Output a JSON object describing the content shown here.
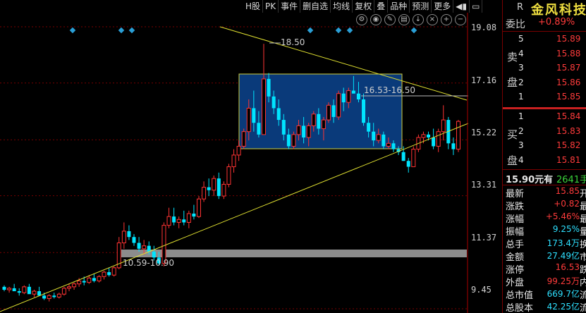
{
  "toolbar": [
    "H股",
    "PK",
    "事件",
    "删自选",
    "均线",
    "复权",
    "叠",
    "品种",
    "预测",
    "更多"
  ],
  "stock_name": "金风科技",
  "stock_code_mark": "R",
  "weibi": {
    "label": "委比",
    "value": "+0.89%"
  },
  "asks": [
    {
      "level": "5",
      "price": "15.89"
    },
    {
      "level": "4",
      "price": "15.88"
    },
    {
      "level": "3",
      "price": "15.87"
    },
    {
      "level": "2",
      "price": "15.86"
    },
    {
      "level": "1",
      "price": "15.85"
    }
  ],
  "ask_side_label": [
    "卖",
    "盘"
  ],
  "bids": [
    {
      "level": "1",
      "price": "15.84"
    },
    {
      "level": "2",
      "price": "15.83"
    },
    {
      "level": "3",
      "price": "15.82"
    },
    {
      "level": "4",
      "price": "15.81"
    }
  ],
  "bid_side_label": [
    "买",
    "盘"
  ],
  "extra_line": {
    "left": "15.90元有",
    "right": "2641手"
  },
  "stats": [
    {
      "label": "最新",
      "value": "15.85",
      "color": "red",
      "tail": "开"
    },
    {
      "label": "涨跌",
      "value": "+0.82",
      "color": "red",
      "tail": "最"
    },
    {
      "label": "涨幅",
      "value": "+5.46%",
      "color": "red",
      "tail": "最"
    },
    {
      "label": "振幅",
      "value": "9.25%",
      "color": "cyan",
      "tail": "量"
    },
    {
      "label": "总手",
      "value": "173.4万",
      "color": "cyan",
      "tail": "换"
    },
    {
      "label": "金额",
      "value": "27.49亿",
      "color": "cyan",
      "tail": "市"
    },
    {
      "label": "涨停",
      "value": "16.53",
      "color": "red",
      "tail": "跌"
    },
    {
      "label": "外盘",
      "value": "99.25万",
      "color": "red",
      "tail": "内"
    },
    {
      "label": "总市值",
      "value": "669.7亿",
      "color": "cyan",
      "tail": "流"
    },
    {
      "label": "总股本",
      "value": "42.25亿",
      "color": "cyan",
      "tail": "流"
    }
  ],
  "y_axis_labels": [
    "19.08",
    "17.16",
    "15.22",
    "13.31",
    "11.37",
    "9.45"
  ],
  "annotations": {
    "peak": "18.50",
    "box_range": "16.53-16.50",
    "support_range": "10.59-10.90"
  },
  "colors": {
    "up": "#ff3333",
    "down": "#00e5ff",
    "trend": "#e0e030",
    "box": "#0a3a7a",
    "marker": "#2a9fd6"
  },
  "chart_data": {
    "type": "candlestick",
    "y_ticks": [
      19.08,
      17.16,
      15.22,
      13.31,
      11.37,
      9.45
    ],
    "ylim": [
      9.0,
      19.6
    ],
    "candles": [
      [
        10.2,
        10.25,
        10.05,
        10.1
      ],
      [
        10.1,
        10.2,
        10.0,
        10.15
      ],
      [
        10.15,
        10.3,
        10.1,
        10.05
      ],
      [
        10.05,
        10.15,
        9.9,
        10.0
      ],
      [
        10.0,
        10.25,
        9.95,
        10.2
      ],
      [
        10.2,
        10.3,
        10.0,
        9.95
      ],
      [
        9.95,
        10.1,
        9.85,
        10.05
      ],
      [
        10.05,
        10.2,
        9.95,
        9.9
      ],
      [
        9.9,
        10.0,
        9.75,
        9.8
      ],
      [
        9.8,
        9.95,
        9.7,
        9.9
      ],
      [
        9.9,
        10.0,
        9.8,
        9.85
      ],
      [
        9.85,
        10.0,
        9.8,
        9.95
      ],
      [
        9.95,
        10.2,
        9.9,
        10.15
      ],
      [
        10.15,
        10.3,
        10.05,
        10.2
      ],
      [
        10.2,
        10.35,
        10.1,
        10.3
      ],
      [
        10.3,
        10.5,
        10.2,
        10.4
      ],
      [
        10.4,
        10.55,
        10.25,
        10.35
      ],
      [
        10.35,
        10.6,
        10.3,
        10.5
      ],
      [
        10.5,
        10.65,
        10.35,
        10.4
      ],
      [
        10.4,
        10.6,
        10.35,
        10.55
      ],
      [
        10.55,
        10.75,
        10.45,
        10.7
      ],
      [
        10.7,
        10.85,
        10.55,
        10.6
      ],
      [
        10.6,
        10.9,
        10.55,
        10.85
      ],
      [
        10.85,
        11.9,
        10.8,
        11.7
      ],
      [
        11.7,
        12.4,
        11.5,
        12.1
      ],
      [
        12.1,
        12.3,
        11.8,
        11.9
      ],
      [
        11.9,
        12.0,
        11.6,
        11.7
      ],
      [
        11.7,
        11.9,
        11.4,
        11.5
      ],
      [
        11.5,
        11.8,
        11.3,
        11.6
      ],
      [
        11.6,
        11.75,
        11.3,
        11.4
      ],
      [
        11.4,
        11.6,
        11.1,
        11.2
      ],
      [
        11.2,
        11.4,
        10.95,
        11.0
      ],
      [
        11.0,
        12.4,
        10.9,
        12.3
      ],
      [
        12.3,
        12.9,
        12.2,
        12.6
      ],
      [
        12.6,
        12.9,
        12.3,
        12.4
      ],
      [
        12.4,
        12.6,
        12.2,
        12.5
      ],
      [
        12.5,
        12.8,
        12.3,
        12.4
      ],
      [
        12.4,
        12.8,
        12.2,
        12.7
      ],
      [
        12.7,
        13.0,
        12.5,
        12.6
      ],
      [
        12.6,
        13.3,
        12.55,
        13.2
      ],
      [
        13.2,
        13.8,
        13.1,
        13.6
      ],
      [
        13.6,
        13.9,
        13.3,
        13.5
      ],
      [
        13.5,
        14.0,
        13.3,
        13.9
      ],
      [
        13.9,
        14.1,
        13.2,
        13.3
      ],
      [
        13.3,
        13.8,
        13.2,
        13.7
      ],
      [
        13.7,
        14.4,
        13.6,
        14.3
      ],
      [
        14.3,
        14.9,
        14.1,
        14.7
      ],
      [
        14.7,
        15.2,
        14.5,
        15.0
      ],
      [
        15.0,
        15.6,
        14.9,
        15.5
      ],
      [
        15.5,
        16.6,
        15.2,
        16.3
      ],
      [
        16.3,
        16.9,
        15.5,
        15.8
      ],
      [
        15.8,
        16.2,
        15.3,
        15.4
      ],
      [
        15.4,
        18.5,
        15.4,
        17.3
      ],
      [
        17.3,
        17.5,
        16.5,
        16.7
      ],
      [
        16.7,
        16.9,
        16.1,
        16.3
      ],
      [
        16.3,
        16.6,
        15.7,
        15.9
      ],
      [
        15.9,
        16.1,
        15.2,
        15.4
      ],
      [
        15.4,
        15.6,
        14.9,
        15.0
      ],
      [
        15.0,
        15.5,
        14.9,
        15.4
      ],
      [
        15.4,
        15.9,
        15.2,
        15.7
      ],
      [
        15.7,
        16.0,
        15.1,
        15.3
      ],
      [
        15.3,
        15.8,
        15.0,
        15.7
      ],
      [
        15.7,
        16.2,
        15.5,
        16.1
      ],
      [
        16.1,
        16.3,
        15.4,
        15.6
      ],
      [
        15.6,
        16.0,
        15.2,
        15.9
      ],
      [
        15.9,
        16.5,
        15.8,
        16.4
      ],
      [
        16.4,
        16.6,
        15.8,
        16.0
      ],
      [
        16.0,
        16.9,
        15.9,
        16.8
      ],
      [
        16.8,
        17.0,
        16.2,
        16.5
      ],
      [
        16.5,
        17.0,
        16.3,
        16.9
      ],
      [
        16.9,
        17.4,
        16.8,
        16.8
      ],
      [
        16.8,
        17.2,
        16.5,
        16.6
      ],
      [
        16.6,
        16.8,
        15.7,
        15.8
      ],
      [
        15.8,
        16.0,
        15.3,
        15.5
      ],
      [
        15.5,
        15.8,
        15.0,
        15.2
      ],
      [
        15.2,
        15.6,
        15.1,
        15.4
      ],
      [
        15.4,
        15.5,
        14.9,
        15.0
      ],
      [
        15.0,
        15.3,
        14.9,
        15.1
      ],
      [
        15.1,
        15.2,
        14.8,
        14.9
      ],
      [
        14.9,
        15.0,
        14.7,
        14.8
      ],
      [
        14.8,
        15.0,
        14.5,
        14.5
      ],
      [
        14.5,
        14.6,
        14.1,
        14.3
      ],
      [
        14.3,
        15.0,
        14.3,
        14.9
      ],
      [
        14.9,
        15.4,
        14.8,
        15.3
      ],
      [
        15.3,
        15.5,
        15.1,
        15.4
      ],
      [
        15.4,
        15.5,
        15.2,
        15.3
      ],
      [
        15.3,
        15.6,
        14.9,
        15.0
      ],
      [
        15.0,
        15.6,
        14.8,
        15.5
      ],
      [
        15.5,
        16.4,
        15.2,
        15.9
      ],
      [
        15.9,
        16.0,
        14.9,
        15.1
      ],
      [
        15.1,
        15.3,
        14.7,
        14.9
      ],
      [
        14.9,
        15.9,
        14.8,
        15.85
      ]
    ]
  }
}
